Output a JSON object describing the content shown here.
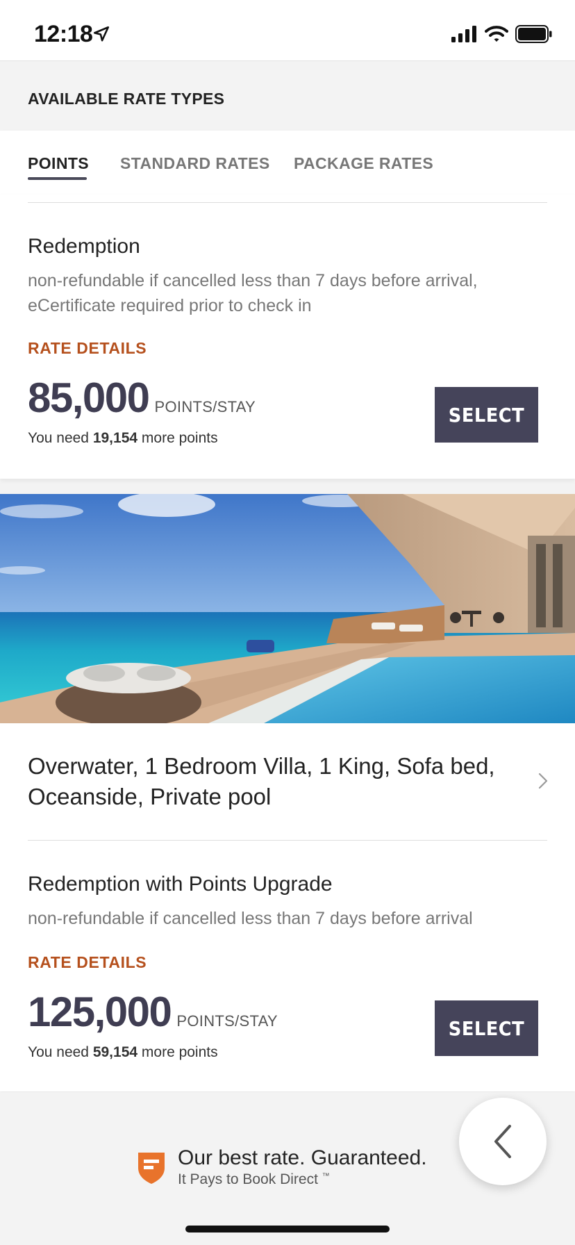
{
  "status_bar": {
    "time": "12:18",
    "icons": [
      "location-arrow-icon",
      "cellular-signal-icon",
      "wifi-icon",
      "battery-icon"
    ]
  },
  "section": {
    "title": "AVAILABLE RATE TYPES"
  },
  "tabs": [
    {
      "label": "POINTS",
      "active": true
    },
    {
      "label": "STANDARD RATES",
      "active": false
    },
    {
      "label": "PACKAGE RATES",
      "active": false
    }
  ],
  "rate1": {
    "name": "Redemption",
    "description": "non-refundable if cancelled less than 7 days before arrival, eCertificate required prior to check in",
    "details_label": "RATE DETAILS",
    "points": "85,000",
    "unit": "POINTS/STAY",
    "need_prefix": "You need ",
    "need_amount": "19,154",
    "need_suffix": " more points",
    "select_label": "SELECT"
  },
  "room": {
    "title": "Overwater, 1 Bedroom Villa, 1 King, Sofa bed, Oceanside, Private pool"
  },
  "rate2": {
    "name": "Redemption with Points Upgrade",
    "description": "non-refundable if cancelled less than 7 days before arrival",
    "details_label": "RATE DETAILS",
    "points": "125,000",
    "unit": "POINTS/STAY",
    "need_prefix": "You need ",
    "need_amount": "59,154",
    "need_suffix": " more points",
    "select_label": "SELECT"
  },
  "footer": {
    "title": "Our best rate. Guaranteed.",
    "subtitle": "It Pays to Book Direct",
    "trademark": "™"
  },
  "colors": {
    "accent": "#b5501d",
    "button": "#45445a",
    "points": "#3f3d52"
  }
}
